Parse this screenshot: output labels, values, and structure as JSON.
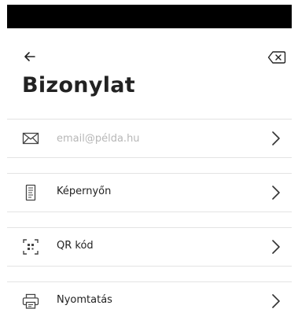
{
  "header": {
    "title": "Bizonylat",
    "back_icon": "arrow-left-icon",
    "clear_icon": "backspace-clear-icon"
  },
  "options": [
    {
      "id": "email",
      "icon": "envelope-icon",
      "label": "",
      "value": "",
      "placeholder": "email@példa.hu"
    },
    {
      "id": "screen",
      "icon": "receipt-icon",
      "label": "Képernyőn"
    },
    {
      "id": "qr",
      "icon": "qr-code-icon",
      "label": "QR kód"
    },
    {
      "id": "print",
      "icon": "printer-icon",
      "label": "Nyomtatás"
    }
  ],
  "colors": {
    "text": "#222222",
    "placeholder": "#b7b7b7",
    "divider": "#e3e3e3",
    "icon": "#444444",
    "status_bar": "#000000"
  }
}
